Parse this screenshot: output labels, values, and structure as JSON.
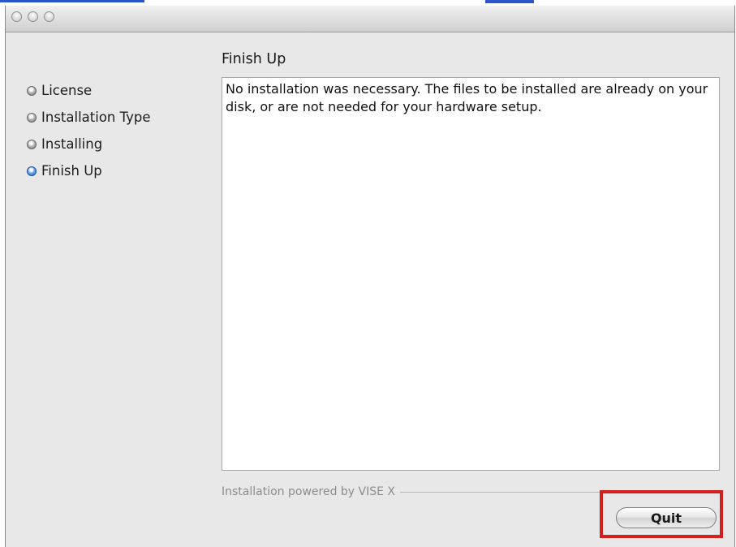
{
  "window": {
    "title": ""
  },
  "steps": [
    {
      "label": "License",
      "active": false
    },
    {
      "label": "Installation Type",
      "active": false
    },
    {
      "label": "Installing",
      "active": false
    },
    {
      "label": "Finish Up",
      "active": true
    }
  ],
  "main": {
    "title": "Finish Up",
    "message": "No installation was necessary.  The files to be installed are already on your disk, or are not needed for your hardware setup."
  },
  "footer": {
    "powered_by": "Installation powered by VISE X",
    "quit_label": "Quit"
  },
  "colors": {
    "highlight_box": "#d3201f",
    "active_bullet": "#2a63c8",
    "window_bg": "#e8e8e8"
  },
  "icons": {
    "step_bullet": "bullet-icon",
    "window_controls": [
      "close-button",
      "minimize-button",
      "zoom-button"
    ]
  }
}
